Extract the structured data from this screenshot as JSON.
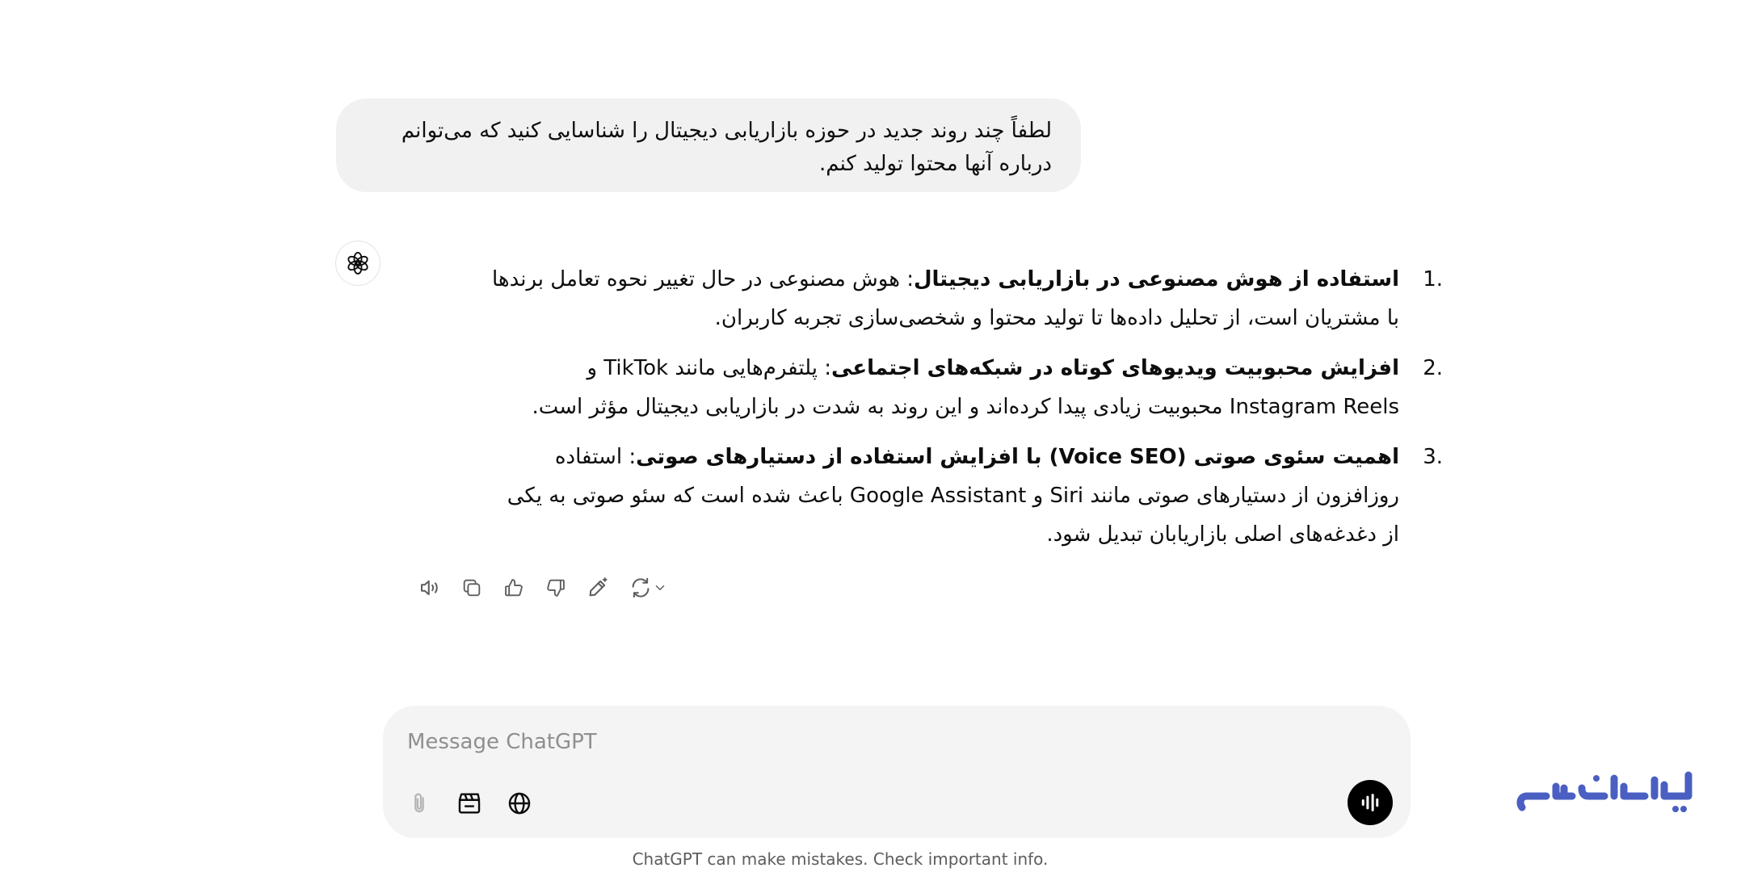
{
  "user_message": {
    "text": "لطفاً چند روند جدید در حوزه بازاریابی دیجیتال را شناسایی کنید که می‌توانم درباره آنها محتوا تولید کنم."
  },
  "assistant": {
    "items": [
      {
        "num": "1.",
        "title": "استفاده از هوش مصنوعی در بازاریابی دیجیتال",
        "body": ": هوش مصنوعی در حال تغییر نحوه تعامل برندها با مشتریان است، از تحلیل داده‌ها تا تولید محتوا و شخصی‌سازی تجربه کاربران."
      },
      {
        "num": "2.",
        "title": "افزایش محبوبیت ویدیوهای کوتاه در شبکه‌های اجتماعی",
        "body": ": پلتفرم‌هایی مانند TikTok و Instagram Reels محبوبیت زیادی پیدا کرده‌اند و این روند به شدت در بازاریابی دیجیتال مؤثر است."
      },
      {
        "num": "3.",
        "title": "اهمیت سئوی صوتی (Voice SEO) با افزایش استفاده از دستیارهای صوتی",
        "body": ": استفاده روزافزون از دستیارهای صوتی مانند Siri و Google Assistant باعث شده است که سئو صوتی به یکی از دغدغه‌های اصلی بازاریابان تبدیل شود."
      }
    ]
  },
  "actions": {
    "icons": [
      "read-aloud-icon",
      "copy-icon",
      "thumbs-up-icon",
      "thumbs-down-icon",
      "edit-canvas-icon",
      "regenerate-icon"
    ]
  },
  "composer": {
    "placeholder": "Message ChatGPT",
    "value": ""
  },
  "footer": {
    "disclaimer": "ChatGPT can make mistakes. Check important info."
  },
  "watermark": {
    "text": "ایران سرور",
    "color": "#4a5fc1"
  }
}
